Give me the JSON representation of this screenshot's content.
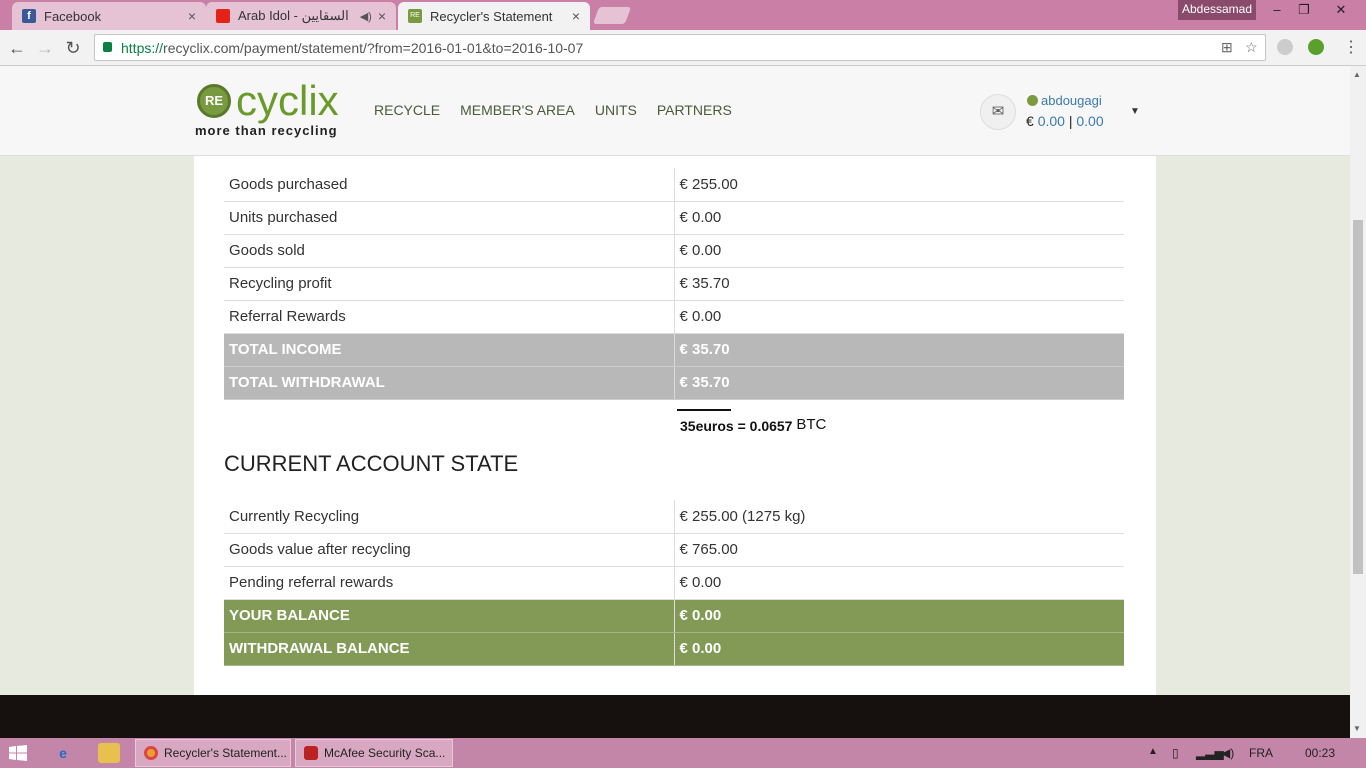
{
  "browser": {
    "tabs": [
      {
        "title": "Facebook",
        "close": "×"
      },
      {
        "title": "Arab Idol - السقايين",
        "close": "×"
      },
      {
        "title": "Recycler's Statement",
        "close": "×"
      }
    ],
    "window_user": "Abdessamad",
    "url_https": "https://",
    "url_rest": "recyclix.com/payment/statement/?from=2016-01-01&to=2016-10-07"
  },
  "header": {
    "logo_badge": "RE",
    "logo_word": "cyclix",
    "logo_tagline": "more than recycling",
    "nav": [
      "RECYCLE",
      "MEMBER'S AREA",
      "UNITS",
      "PARTNERS"
    ],
    "username": "abdougagi",
    "balance_currency": "€",
    "balance_a": "0.00",
    "balance_sep": "|",
    "balance_b": "0.00"
  },
  "statement": {
    "rows": [
      {
        "label": "Goods purchased",
        "value": "€ 255.00"
      },
      {
        "label": "Units purchased",
        "value": "€ 0.00"
      },
      {
        "label": "Goods sold",
        "value": "€ 0.00"
      },
      {
        "label": "Recycling profit",
        "value": "€ 35.70"
      },
      {
        "label": "Referral Rewards",
        "value": "€ 0.00"
      }
    ],
    "totals": [
      {
        "label": "TOTAL INCOME",
        "value": "€ 35.70"
      },
      {
        "label": "TOTAL WITHDRAWAL",
        "value": "€ 35.70"
      }
    ],
    "annotation": "35euros = 0.0657",
    "annotation_unit": "BTC"
  },
  "account": {
    "title": "CURRENT ACCOUNT STATE",
    "rows": [
      {
        "label": "Currently Recycling",
        "value": "€ 255.00 (1275 kg)"
      },
      {
        "label": "Goods value after recycling",
        "value": "€ 765.00"
      },
      {
        "label": "Pending referral rewards",
        "value": "€ 0.00"
      }
    ],
    "balances": [
      {
        "label": "YOUR BALANCE",
        "value": "€ 0.00"
      },
      {
        "label": "WITHDRAWAL BALANCE",
        "value": "€ 0.00"
      }
    ]
  },
  "taskbar": {
    "items": [
      "Recycler's Statement...",
      "McAfee Security Sca..."
    ],
    "language": "FRA",
    "time": "00:23"
  }
}
